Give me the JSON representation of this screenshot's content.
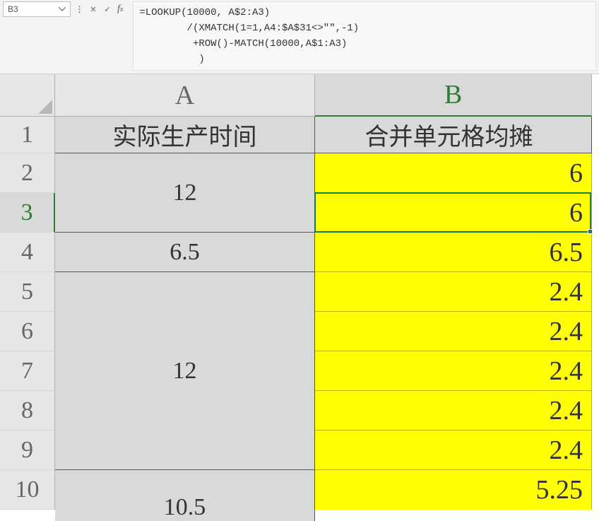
{
  "formula_bar": {
    "cell_ref": "B3",
    "formula_text": "=LOOKUP(10000, A$2:A3)\n        /(XMATCH(1=1,A4:$A$31<>\"\",-1)\n         +ROW()-MATCH(10000,A$1:A3)\n          )"
  },
  "columns": {
    "a": "A",
    "b": "B"
  },
  "row_numbers": [
    "1",
    "2",
    "3",
    "4",
    "5",
    "6",
    "7",
    "8",
    "9",
    "10"
  ],
  "headers": {
    "a": "实际生产时间",
    "b": "合并单元格均摊"
  },
  "column_a_merged": [
    {
      "value": "12",
      "rows": 2
    },
    {
      "value": "6.5",
      "rows": 1
    },
    {
      "value": "12",
      "rows": 5
    },
    {
      "value": "10.5",
      "rows": 2
    }
  ],
  "column_b": [
    "6",
    "6",
    "6.5",
    "2.4",
    "2.4",
    "2.4",
    "2.4",
    "2.4",
    "5.25"
  ]
}
